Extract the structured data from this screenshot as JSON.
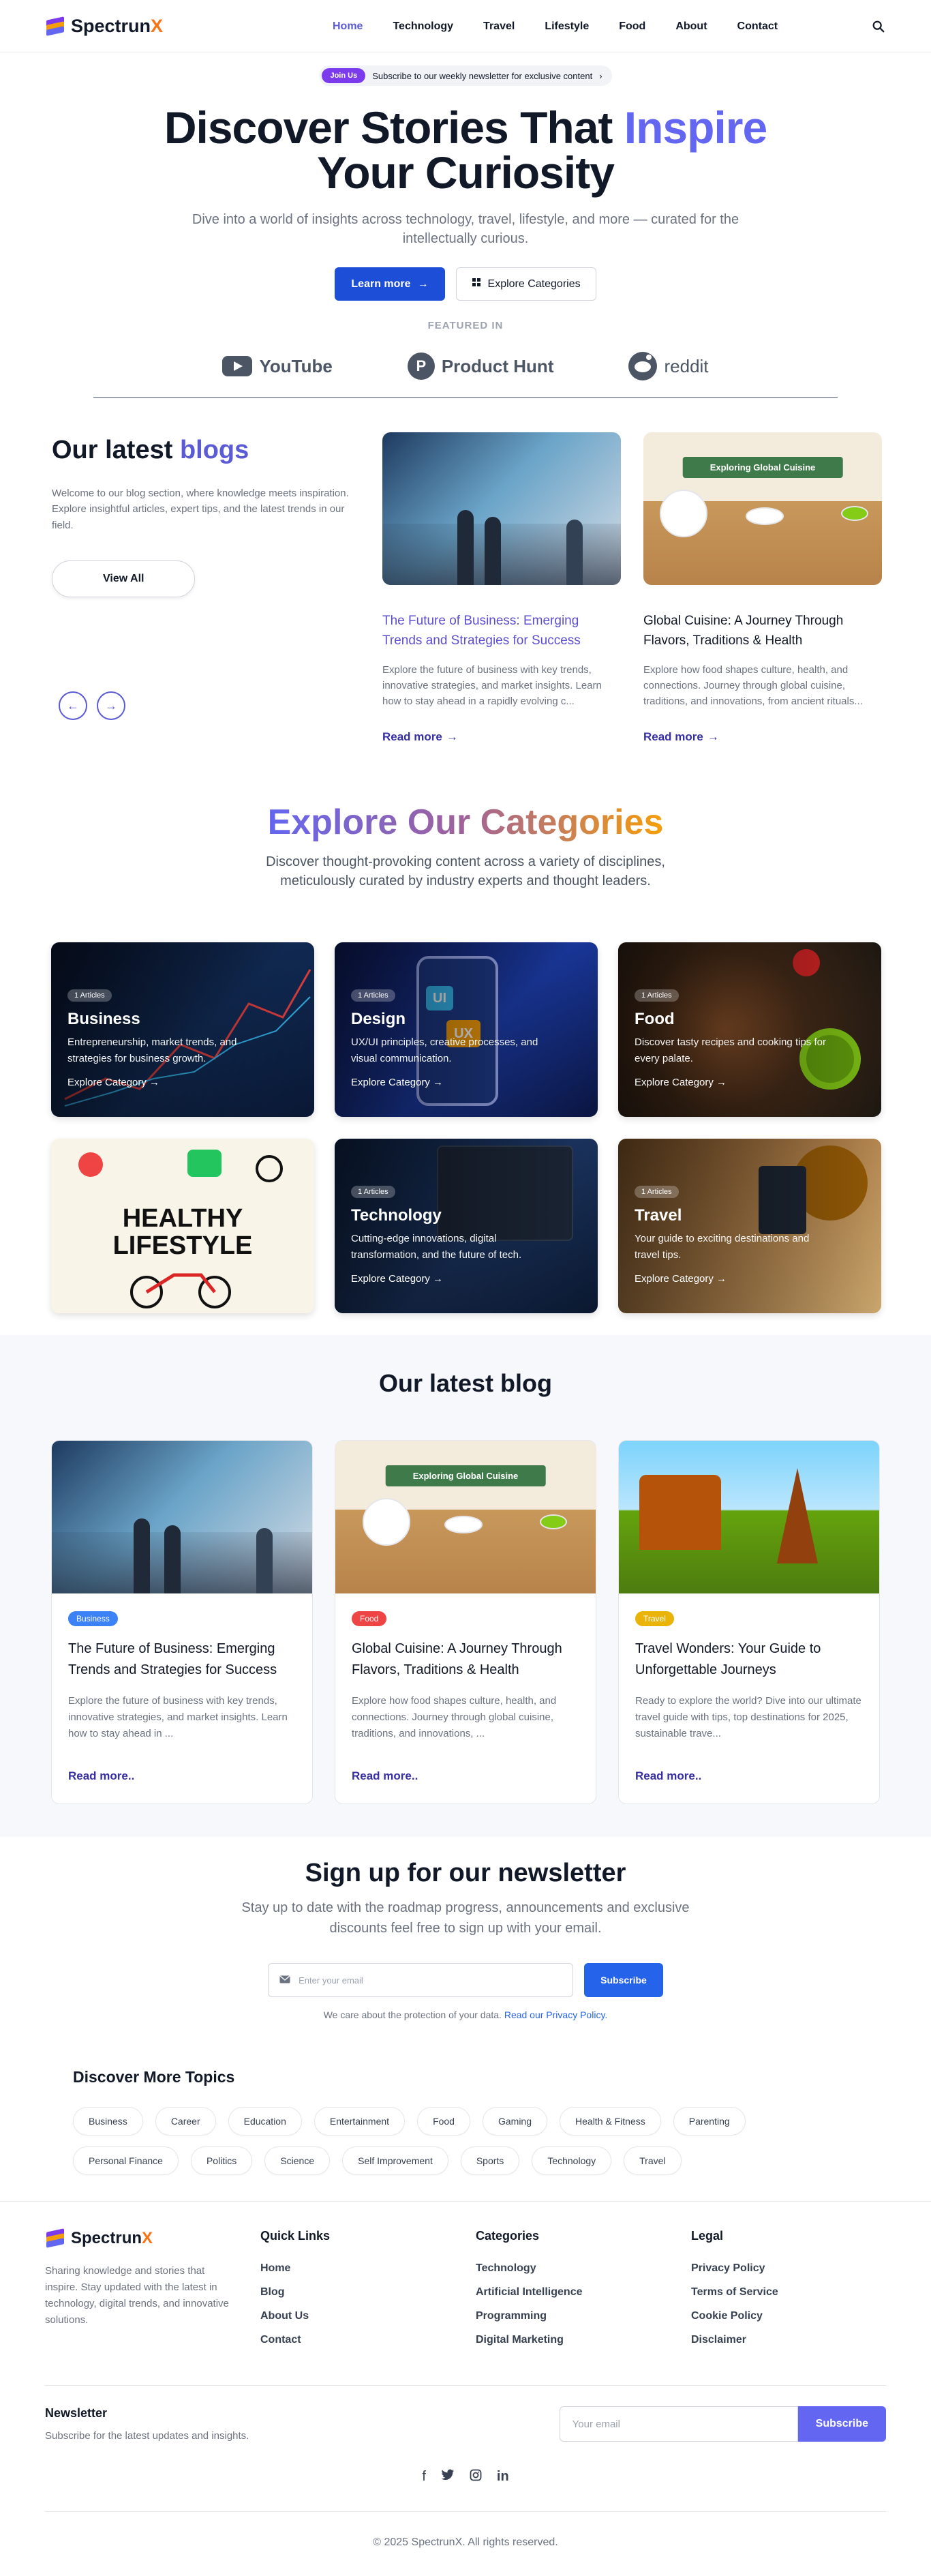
{
  "brand": {
    "name_main": "Spectrun",
    "name_x": "X"
  },
  "nav": {
    "links": [
      {
        "label": "Home"
      },
      {
        "label": "Technology"
      },
      {
        "label": "Travel"
      },
      {
        "label": "Lifestyle"
      },
      {
        "label": "Food"
      },
      {
        "label": "About"
      },
      {
        "label": "Contact"
      }
    ],
    "search_icon": "search-icon"
  },
  "hero": {
    "badge": "Join Us",
    "announcement": "Subscribe to our weekly newsletter for exclusive content",
    "title_pre": "Discover Stories That ",
    "title_accent": "Inspire",
    "title_post": " Your Curiosity",
    "subtitle": "Dive into a world of insights across technology, travel, lifestyle, and more — curated for the intellectually curious.",
    "cta_primary": "Learn more",
    "cta_secondary": "Explore Categories",
    "featured_label": "FEATURED IN",
    "brands": [
      "YouTube",
      "Product Hunt",
      "reddit"
    ]
  },
  "latest": {
    "title_pre": "Our latest ",
    "title_accent": "blogs",
    "description": "Welcome to our blog section, where knowledge meets inspiration. Explore insightful articles, expert tips, and the latest trends in our field.",
    "view_all": "View All",
    "cards": [
      {
        "title": "The Future of Business: Emerging Trends and Strategies for Success",
        "excerpt": "Explore the future of business with key trends, innovative strategies, and market insights. Learn how to stay ahead in a rapidly evolving c...",
        "read": "Read more"
      },
      {
        "title": "Global Cuisine: A Journey Through Flavors, Traditions & Health",
        "excerpt": "Explore how food shapes culture, health, and connections. Journey through global cuisine, traditions, and innovations, from ancient rituals...",
        "read": "Read more",
        "banner": "Exploring Global Cuisine"
      }
    ]
  },
  "categories": {
    "title": "Explore Our Categories",
    "subtitle": "Discover thought-provoking content across a variety of disciplines, meticulously curated by industry experts and thought leaders.",
    "items": [
      {
        "count": "1 Articles",
        "name": "Business",
        "desc": "Entrepreneurship, market trends, and strategies for business growth.",
        "link": "Explore Category →"
      },
      {
        "count": "1 Articles",
        "name": "Design",
        "desc": "UX/UI principles, creative processes, and visual communication.",
        "link": "Explore Category →"
      },
      {
        "count": "1 Articles",
        "name": "Food",
        "desc": "Discover tasty recipes and cooking tips for every palate.",
        "link": "Explore Category →"
      },
      {
        "count": "",
        "name": "Lifestyle",
        "desc": "",
        "link": ""
      },
      {
        "count": "1 Articles",
        "name": "Technology",
        "desc": "Cutting-edge innovations, digital transformation, and the future of tech.",
        "link": "Explore Category →"
      },
      {
        "count": "1 Articles",
        "name": "Travel",
        "desc": "Your guide to exciting destinations and travel tips.",
        "link": "Explore Category →"
      }
    ],
    "lifestyle_art": {
      "line1": "HEALTHY",
      "line2": "LIFESTYLE"
    }
  },
  "blog2": {
    "title": "Our latest blog",
    "cards": [
      {
        "tag": "Business",
        "tag_color": "#3b82f6",
        "title": "The Future of Business: Emerging Trends and Strategies for Success",
        "excerpt": "Explore the future of business with key trends, innovative strategies, and market insights. Learn how to stay ahead in ...",
        "read": "Read more.."
      },
      {
        "tag": "Food",
        "tag_color": "#ef4444",
        "title": "Global Cuisine: A Journey Through Flavors, Traditions & Health",
        "excerpt": "Explore how food shapes culture, health, and connections. Journey through global cuisine, traditions, and innovations, ...",
        "read": "Read more..",
        "banner": "Exploring Global Cuisine"
      },
      {
        "tag": "Travel",
        "tag_color": "#eab308",
        "title": "Travel Wonders: Your Guide to Unforgettable Journeys",
        "excerpt": "Ready to explore the world? Dive into our ultimate travel guide with tips, top destinations for 2025, sustainable trave...",
        "read": "Read more.."
      }
    ]
  },
  "newsletter": {
    "title": "Sign up for our newsletter",
    "subtitle": "Stay up to date with the roadmap progress, announcements and exclusive discounts feel free to sign up with your email.",
    "placeholder": "Enter your email",
    "button": "Subscribe",
    "note": "We care about the protection of your data. ",
    "note_link": "Read our Privacy Policy."
  },
  "topics": {
    "title": "Discover More Topics",
    "items": [
      "Business",
      "Career",
      "Education",
      "Entertainment",
      "Food",
      "Gaming",
      "Health & Fitness",
      "Parenting",
      "Personal Finance",
      "Politics",
      "Science",
      "Self Improvement",
      "Sports",
      "Technology",
      "Travel"
    ]
  },
  "footer": {
    "description": "Sharing knowledge and stories that inspire. Stay updated with the latest in technology, digital trends, and innovative solutions.",
    "quick_links": {
      "title": "Quick Links",
      "items": [
        "Home",
        "Blog",
        "About Us",
        "Contact"
      ]
    },
    "categories": {
      "title": "Categories",
      "items": [
        "Technology",
        "Artificial Intelligence",
        "Programming",
        "Digital Marketing"
      ]
    },
    "legal": {
      "title": "Legal",
      "items": [
        "Privacy Policy",
        "Terms of Service",
        "Cookie Policy",
        "Disclaimer"
      ]
    },
    "newsletter_title": "Newsletter",
    "newsletter_sub": "Subscribe for the latest updates and insights.",
    "newsletter_placeholder": "Your email",
    "newsletter_button": "Subscribe",
    "copyright": "© 2025 SpectrunX. All rights reserved."
  },
  "colors": {
    "accent": "#6366f1",
    "primary_button": "#1d4ed8",
    "brand_x": "#f97316"
  }
}
